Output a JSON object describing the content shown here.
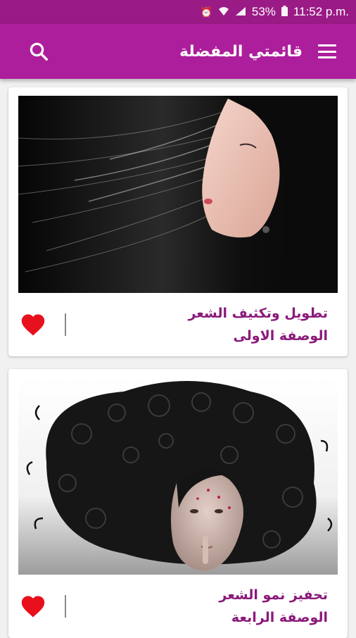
{
  "status_bar": {
    "battery": "53%",
    "time": "11:52 p.m.",
    "icons": [
      "alarm-icon",
      "wifi-icon",
      "signal-icon",
      "battery-icon"
    ]
  },
  "app_bar": {
    "title": "قائمتي المفضلة",
    "menu_icon": "menu-icon",
    "search_icon": "search-icon"
  },
  "cards": [
    {
      "title": "تطويل وتكثيف الشعر",
      "subtitle": "الوصفة الاولى",
      "image": "woman with long straight black hair",
      "favorite": true
    },
    {
      "title": "تحفيز نمو الشعر",
      "subtitle": "الوصفة الرابعة",
      "image": "woman with curly black hair spread out",
      "favorite": true
    }
  ],
  "colors": {
    "status_bar": "#9b1b86",
    "app_bar": "#ad1e9c",
    "text_accent": "#8a1a7a",
    "heart": "#e8101c"
  }
}
